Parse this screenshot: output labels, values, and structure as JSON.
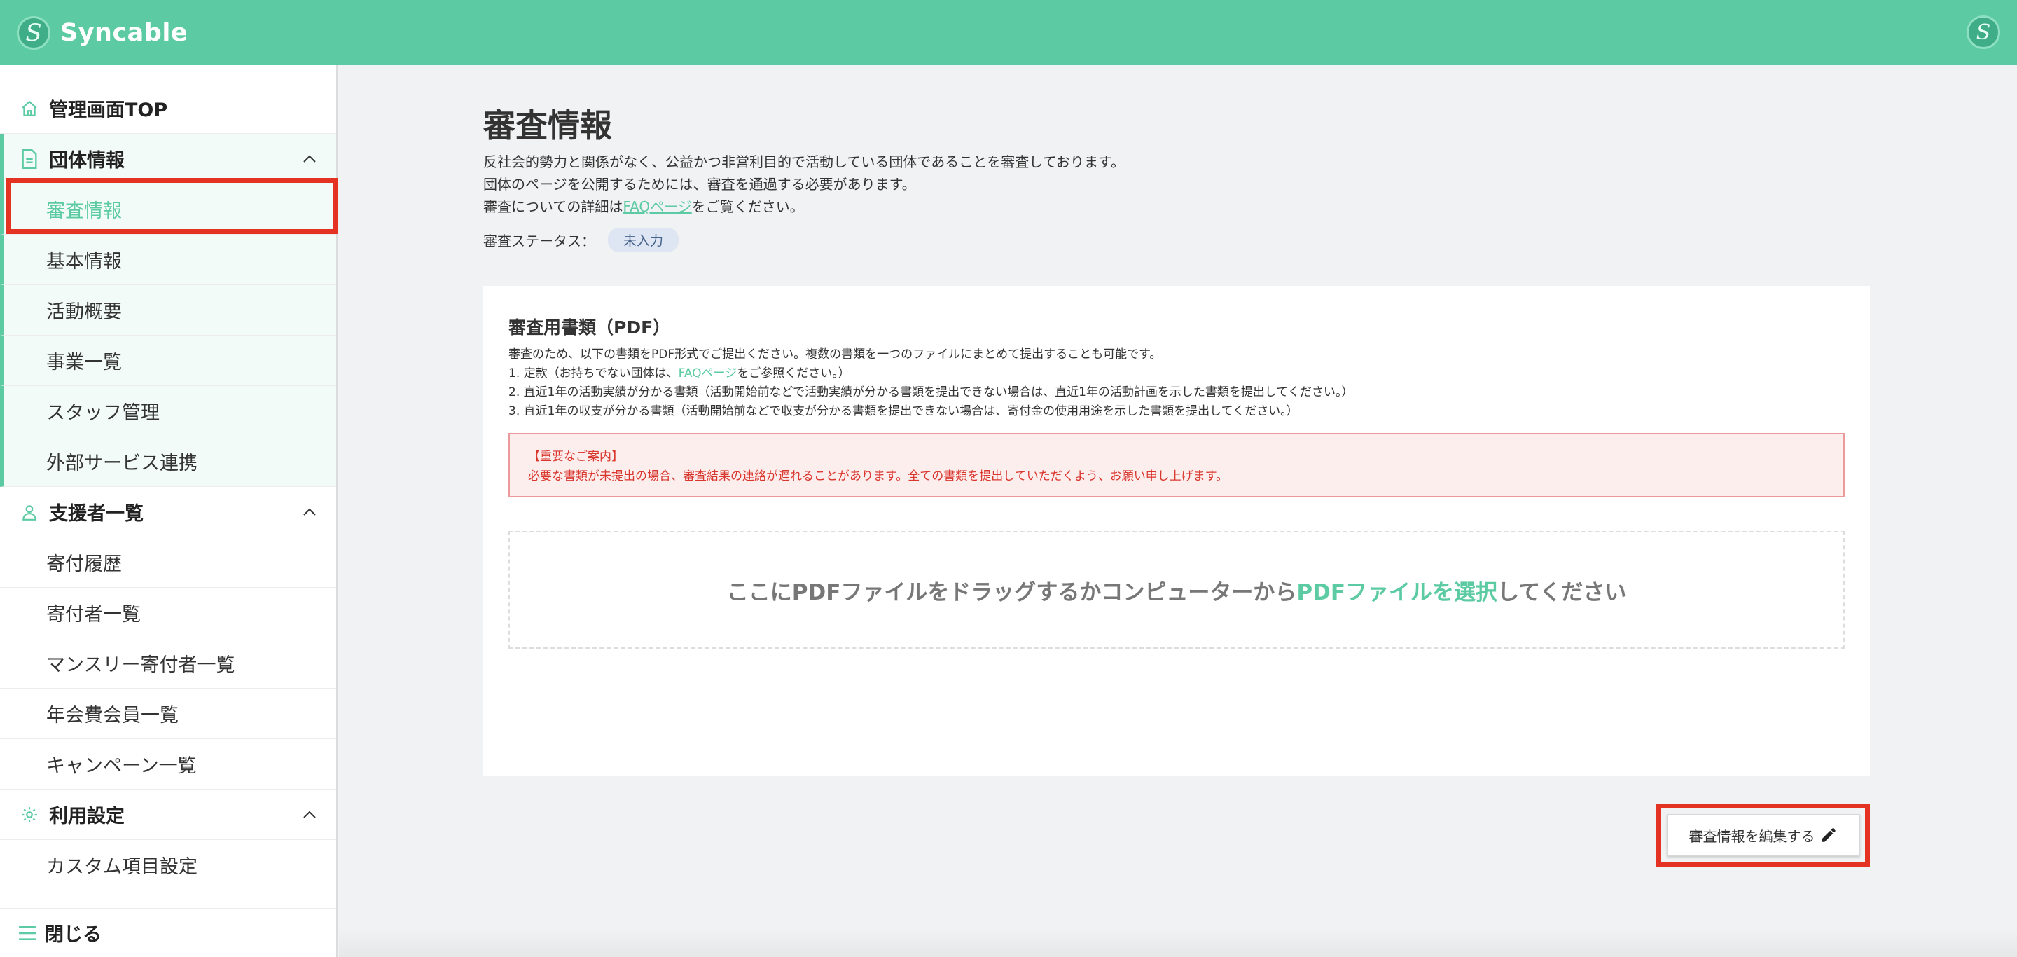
{
  "header": {
    "brand": "Syncable",
    "logo_letter": "S",
    "avatar_letter": "S"
  },
  "sidebar": {
    "top": {
      "label": "管理画面TOP",
      "icon": "home-icon"
    },
    "groups": [
      {
        "label": "団体情報",
        "icon": "document-icon",
        "expanded": true,
        "items": [
          "審査情報",
          "基本情報",
          "活動概要",
          "事業一覧",
          "スタッフ管理",
          "外部サービス連携"
        ]
      },
      {
        "label": "支援者一覧",
        "icon": "person-icon",
        "expanded": true,
        "items": [
          "寄付履歴",
          "寄付者一覧",
          "マンスリー寄付者一覧",
          "年会費会員一覧",
          "キャンペーン一覧"
        ]
      },
      {
        "label": "利用設定",
        "icon": "gear-icon",
        "expanded": true,
        "items": [
          "カスタム項目設定"
        ]
      }
    ],
    "active_item": "審査情報",
    "close_label": "閉じる"
  },
  "main": {
    "title": "審査情報",
    "intro_lines": [
      "反社会的勢力と関係がなく、公益かつ非営利目的で活動している団体であることを審査しております。",
      "団体のページを公開するためには、審査を通過する必要があります。"
    ],
    "intro_line3_prefix": "審査についての詳細は",
    "intro_line3_link": "FAQページ",
    "intro_line3_suffix": "をご覧ください。",
    "status_label": "審査ステータス：",
    "status_value": "未入力",
    "card": {
      "title": "審査用書類（PDF）",
      "desc": "審査のため、以下の書類をPDF形式でご提出ください。複数の書類を一つのファイルにまとめて提出することも可能です。",
      "item1_prefix": "1. 定款（お持ちでない団体は、",
      "item1_link": "FAQページ",
      "item1_suffix": "をご参照ください。）",
      "item2": "2. 直近1年の活動実績が分かる書類（活動開始前などで活動実績が分かる書類を提出できない場合は、直近1年の活動計画を示した書類を提出してください。）",
      "item3": "3. 直近1年の収支が分かる書類（活動開始前などで収支が分かる書類を提出できない場合は、寄付金の使用用途を示した書類を提出してください。）",
      "alert_title": "【重要なご案内】",
      "alert_body": "必要な書類が未提出の場合、審査結果の連絡が遅れることがあります。全ての書類を提出していただくよう、お願い申し上げます。",
      "dropzone_prefix": "ここにPDFファイルをドラッグするかコンピューターから",
      "dropzone_link": "PDFファイルを選択",
      "dropzone_suffix": "してください"
    },
    "edit_button": "審査情報を編集する"
  },
  "colors": {
    "brand": "#5ccba3",
    "highlight": "#e53323",
    "alert_text": "#d9372e"
  }
}
